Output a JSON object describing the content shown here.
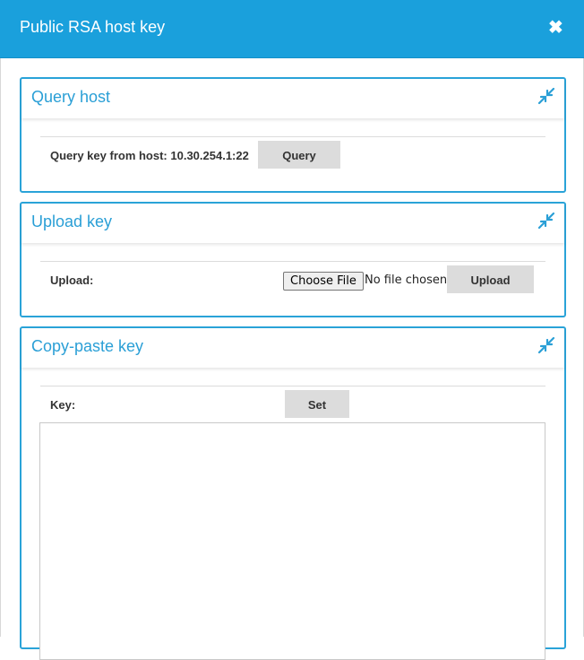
{
  "dialog": {
    "title": "Public RSA host key",
    "close_icon": "close-icon",
    "accent_color": "#1aa0dc"
  },
  "query_host": {
    "title": "Query host",
    "label": "Query key from host: 10.30.254.1:22",
    "button": "Query",
    "collapse_icon": "collapse-arrows-icon"
  },
  "upload_key": {
    "title": "Upload key",
    "label": "Upload:",
    "file_button": "Choose File",
    "file_status": "No file chosen",
    "button": "Upload",
    "collapse_icon": "collapse-arrows-icon"
  },
  "copy_paste_key": {
    "title": "Copy-paste key",
    "label": "Key:",
    "button": "Set",
    "textarea_value": "",
    "collapse_icon": "collapse-arrows-icon"
  }
}
